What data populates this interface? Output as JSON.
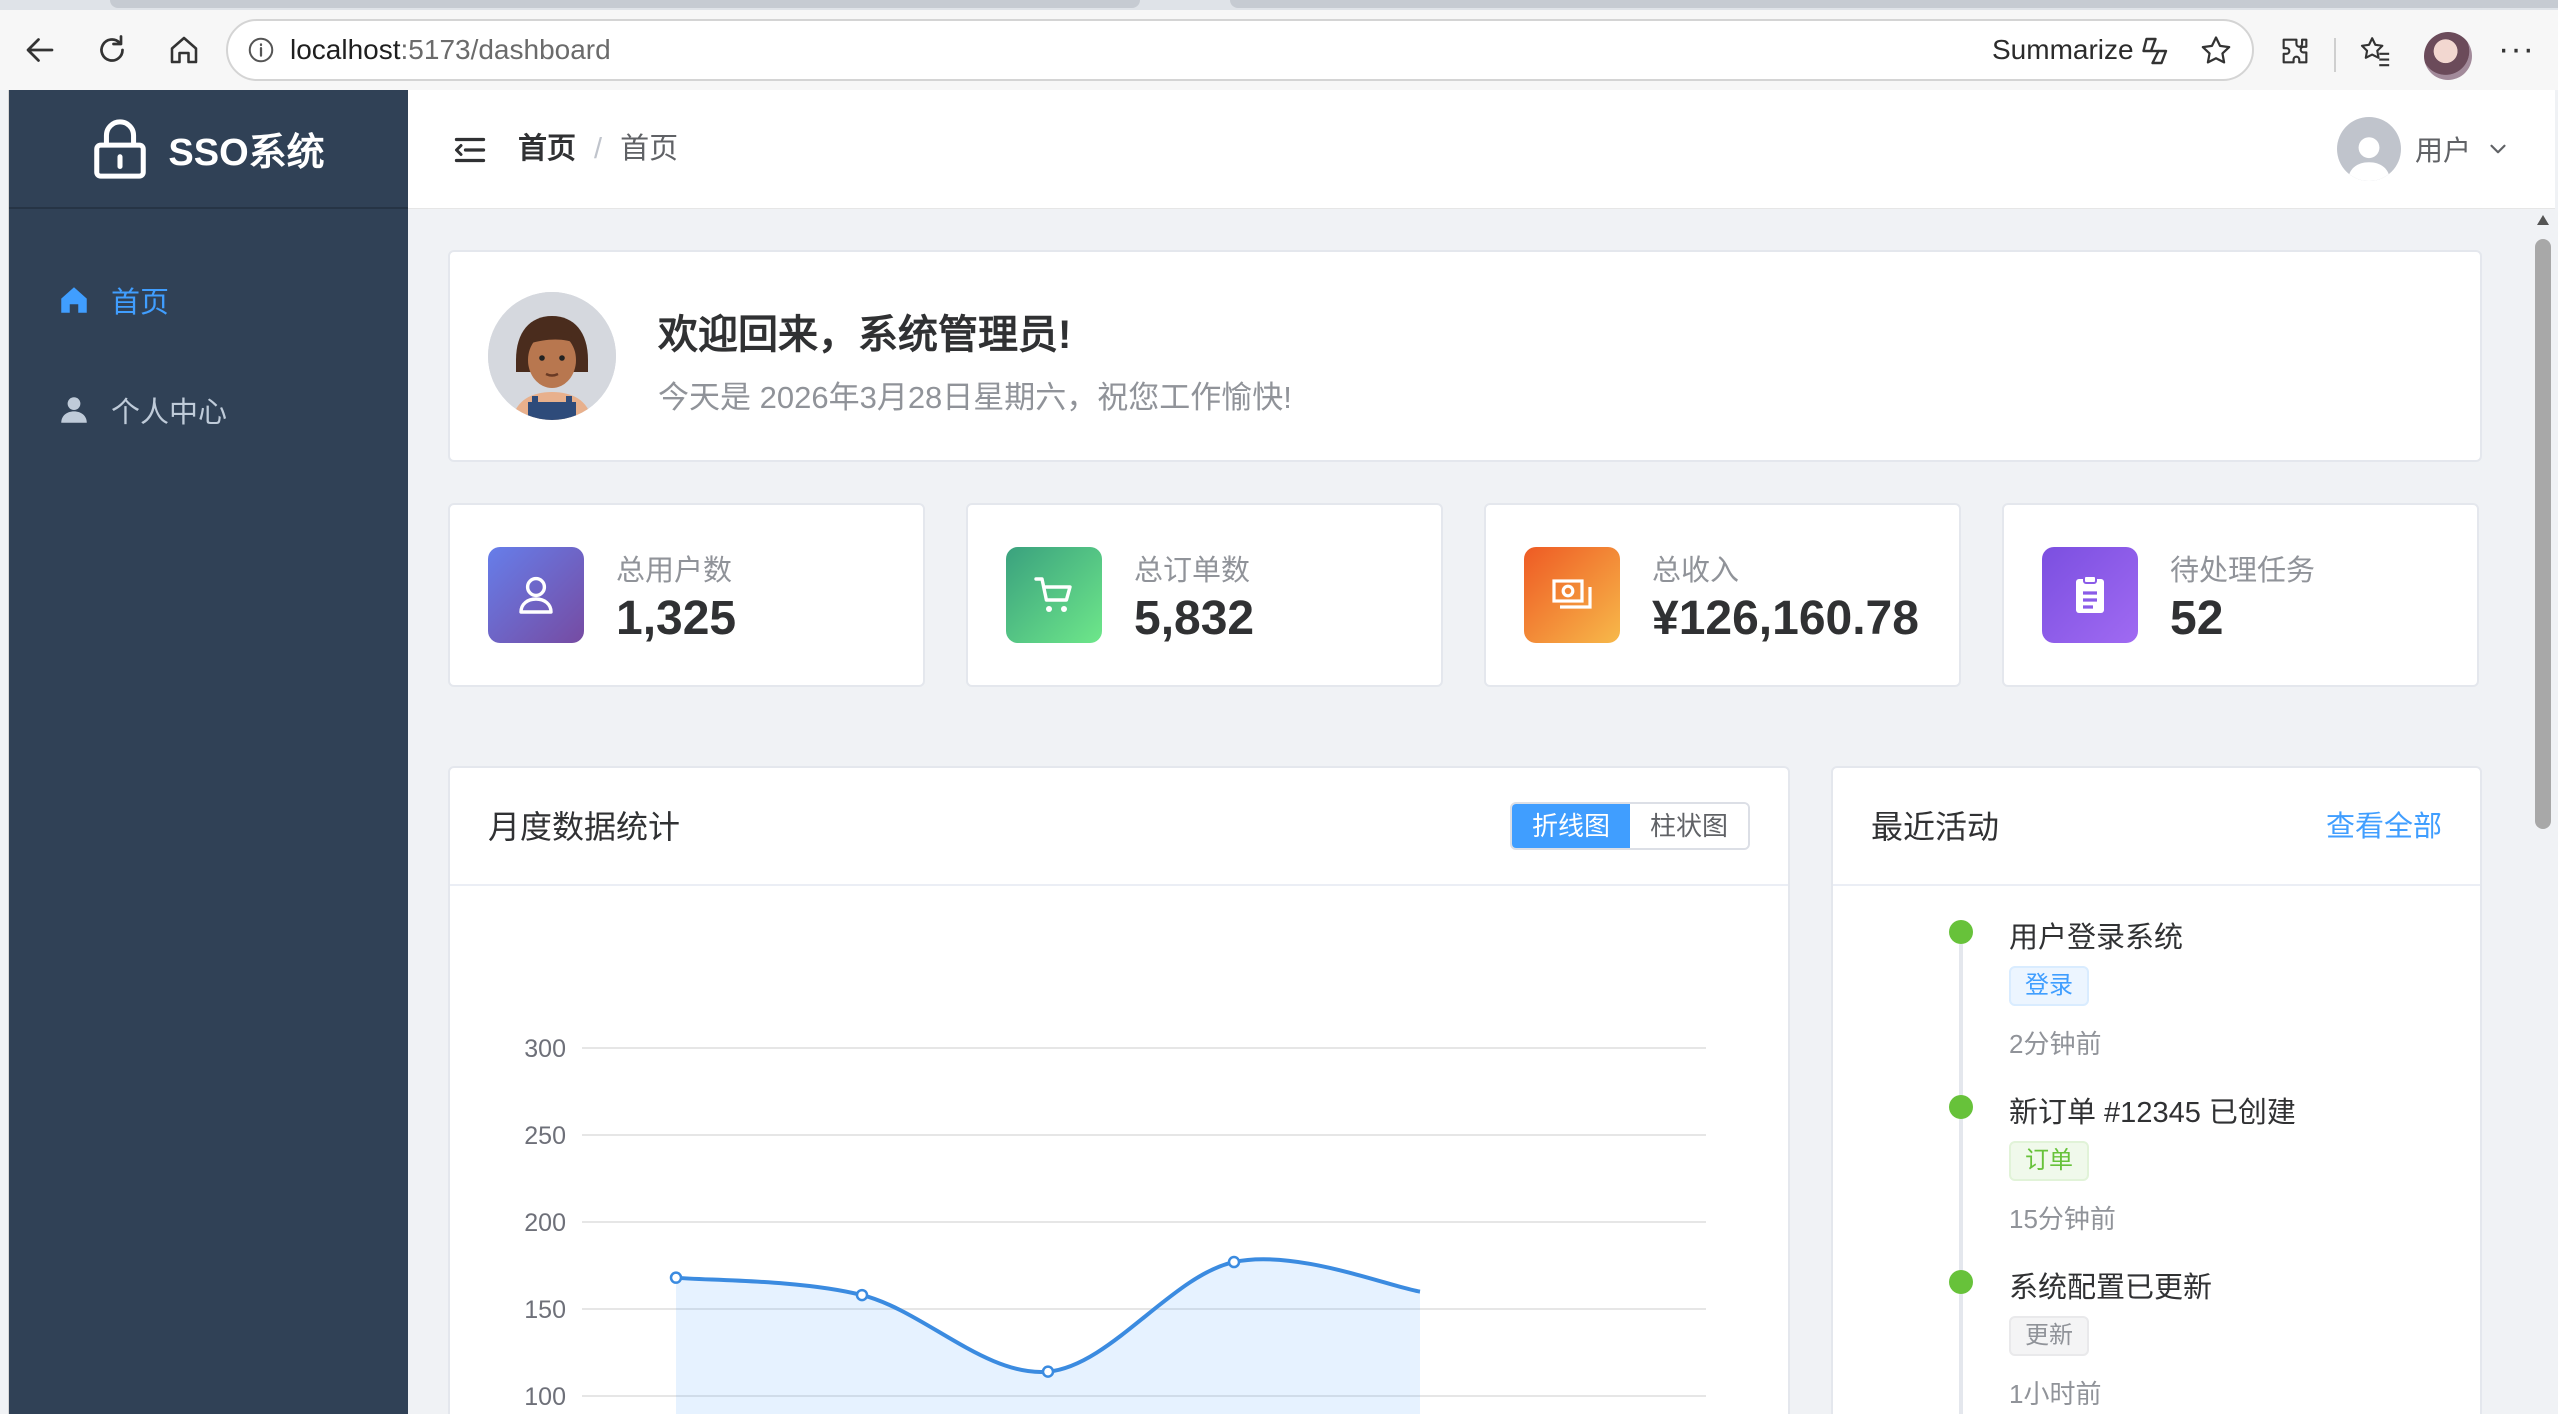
{
  "browser": {
    "url_host": "localhost",
    "url_rest": ":5173/dashboard",
    "summarize_label": "Summarize"
  },
  "sidebar": {
    "brand": "SSO系统",
    "items": [
      {
        "label": "首页",
        "icon": "home-icon",
        "active": true
      },
      {
        "label": "个人中心",
        "icon": "user-icon",
        "active": false
      }
    ]
  },
  "header": {
    "breadcrumb": [
      "首页",
      "首页"
    ],
    "breadcrumb_sep": "/",
    "user_label": "用户"
  },
  "welcome": {
    "title": "欢迎回来，系统管理员!",
    "subtitle": "今天是 2026年3月28日星期六，祝您工作愉快!"
  },
  "stats": [
    {
      "label": "总用户数",
      "value": "1,325",
      "icon": "user-icon",
      "color_from": "#667eea",
      "color_to": "#764ba2"
    },
    {
      "label": "总订单数",
      "value": "5,832",
      "icon": "cart-icon",
      "color_from": "#3aa17e",
      "color_to": "#6ee78a"
    },
    {
      "label": "总收入",
      "value": "¥126,160.78",
      "icon": "money-icon",
      "color_from": "#ee5a24",
      "color_to": "#f7b94a"
    },
    {
      "label": "待处理任务",
      "value": "52",
      "icon": "clipboard-icon",
      "color_from": "#7b4fe0",
      "color_to": "#a06af2"
    }
  ],
  "chart_panel": {
    "title": "月度数据统计",
    "toggle": [
      "折线图",
      "柱状图"
    ],
    "active_toggle": 0
  },
  "chart_data": {
    "type": "line",
    "ylim": [
      0,
      300
    ],
    "yticks": [
      100,
      150,
      200,
      250,
      300
    ],
    "series": [
      {
        "values": [
          168,
          158,
          114,
          177,
          160
        ],
        "color": "#3b8be0",
        "area": true
      }
    ]
  },
  "activity": {
    "title": "最近活动",
    "view_all": "查看全部",
    "items": [
      {
        "text": "用户登录系统",
        "tag": "登录",
        "tag_type": "login",
        "time": "2分钟前"
      },
      {
        "text": "新订单 #12345 已创建",
        "tag": "订单",
        "tag_type": "order",
        "time": "15分钟前"
      },
      {
        "text": "系统配置已更新",
        "tag": "更新",
        "tag_type": "update",
        "time": "1小时前"
      }
    ]
  },
  "colors": {
    "sidebar_bg": "#304156",
    "accent": "#409eff",
    "success": "#67c23a"
  }
}
